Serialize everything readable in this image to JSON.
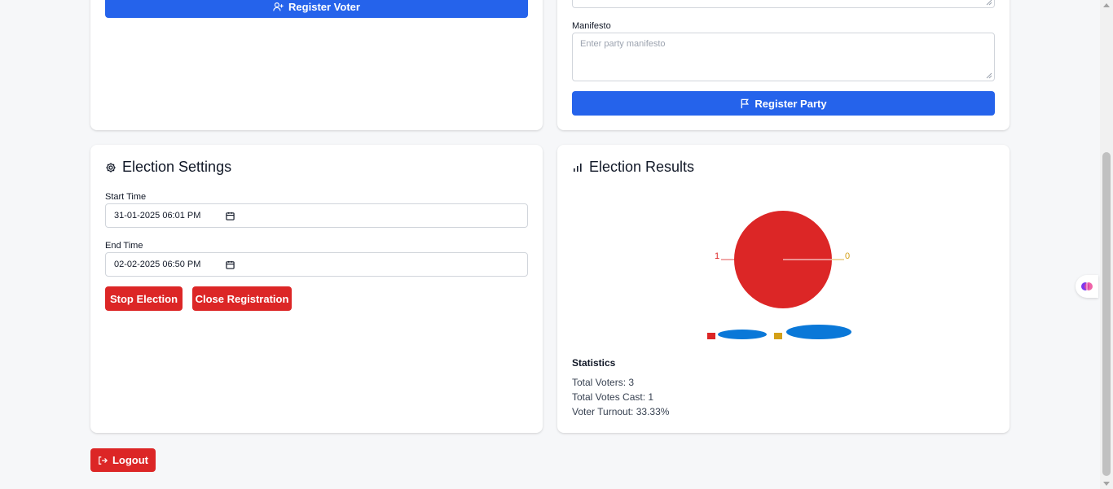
{
  "voter_form": {
    "register_label": "Register Voter"
  },
  "party_form": {
    "manifesto_label": "Manifesto",
    "manifesto_placeholder": "Enter party manifesto",
    "register_label": "Register Party"
  },
  "settings": {
    "title": "Election Settings",
    "start_label": "Start Time",
    "start_value": "31-01-2025 06:01 PM",
    "end_label": "End Time",
    "end_value": "02-02-2025 06:50 PM",
    "stop_label": "Stop Election",
    "close_reg_label": "Close Registration"
  },
  "results": {
    "title": "Election Results",
    "statistics_title": "Statistics",
    "total_voters": "Total Voters: 3",
    "total_votes_cast": "Total Votes Cast: 1",
    "voter_turnout": "Voter Turnout: 33.33%"
  },
  "chart_data": {
    "type": "pie",
    "values": [
      1,
      0
    ],
    "data_labels": [
      "1",
      "0"
    ],
    "colors": [
      "#dc2626",
      "#d4a017"
    ],
    "legend_placement": "bottom"
  },
  "logout_label": "Logout",
  "colors": {
    "primary": "#2563eb",
    "danger": "#dc2626",
    "background": "#f6f7f9"
  }
}
